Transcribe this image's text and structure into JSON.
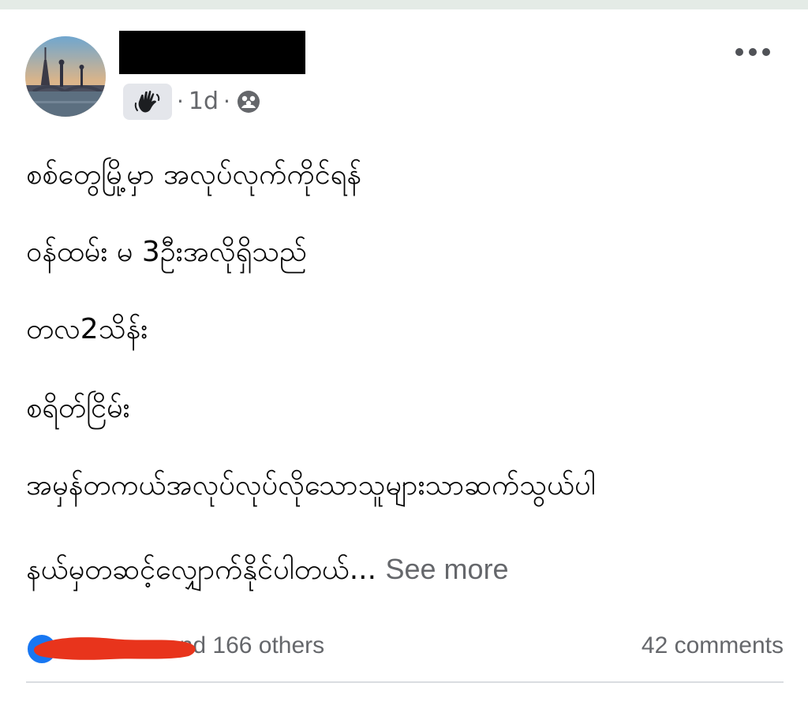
{
  "post": {
    "author": {
      "name_redacted": true
    },
    "meta": {
      "separator": "·",
      "time": "1d",
      "badge_icon": "waving-hand-icon",
      "audience_icon": "friends-group-icon"
    },
    "more_icon": "more-horizontal-icon",
    "lines": [
      "စစ်တွေမြို့မှာ အလုပ်လုက်ကိုင်ရန်",
      "ဝန်ထမ်း မ 3ဦးအလိုရှိသည်",
      "တလ2သိန်း",
      "စရိတ်ငြိမ်း",
      "အမှန်တကယ်အလုပ်လုပ်လိုသောသူများသာဆက်သွယ်ပါ",
      "နယ်မှတဆင့်လျှောက်နိုင်ပါတယ်..."
    ],
    "see_more": "See more",
    "footer": {
      "reaction_icon": "like-icon",
      "reactions_suffix": "and 166 others",
      "comments": "42 comments"
    }
  },
  "colors": {
    "top_strip": "#e4ebe6",
    "secondary_text": "#65676b",
    "like_blue": "#1877f2",
    "redaction_red": "#e8341c"
  }
}
